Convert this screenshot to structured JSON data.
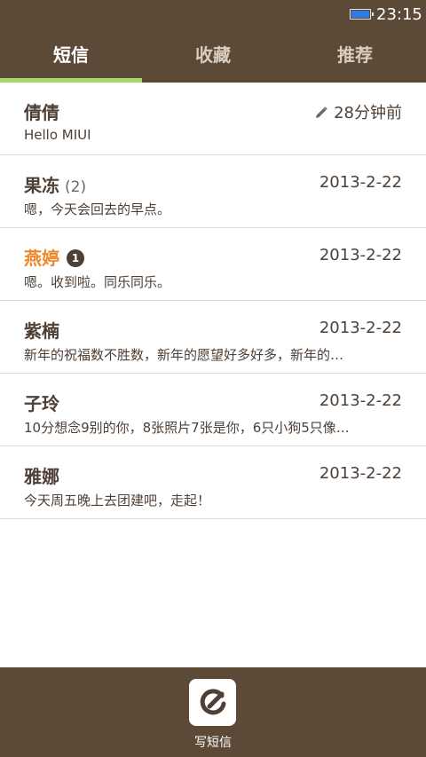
{
  "status_bar": {
    "time": "23:15",
    "battery_icon": "battery-icon"
  },
  "tabs": [
    {
      "label": "短信",
      "active": true
    },
    {
      "label": "收藏",
      "active": false
    },
    {
      "label": "推荐",
      "active": false
    }
  ],
  "colors": {
    "header_bg": "#5c4a37",
    "active_indicator": "#a6d86a",
    "unread_name": "#f0872a"
  },
  "conversations": [
    {
      "name": "倩倩",
      "count": "",
      "unread": "",
      "date": "28分钟前",
      "draft": true,
      "preview": "Hello MIUI"
    },
    {
      "name": "果冻",
      "count": "(2)",
      "unread": "",
      "date": "2013-2-22",
      "draft": false,
      "preview": "嗯，今天会回去的早点。"
    },
    {
      "name": "燕婷",
      "count": "",
      "unread": "1",
      "date": "2013-2-22",
      "draft": false,
      "preview": "嗯。收到啦。同乐同乐。"
    },
    {
      "name": "紫楠",
      "count": "",
      "unread": "",
      "date": "2013-2-22",
      "draft": false,
      "preview": "新年的祝福数不胜数，新年的愿望好多好多，新年的…"
    },
    {
      "name": "子玲",
      "count": "",
      "unread": "",
      "date": "2013-2-22",
      "draft": false,
      "preview": "10分想念9别的你，8张照片7张是你，6只小狗5只像…"
    },
    {
      "name": "雅娜",
      "count": "",
      "unread": "",
      "date": "2013-2-22",
      "draft": false,
      "preview": "今天周五晚上去团建吧，走起！"
    }
  ],
  "bottom_bar": {
    "compose_label": "写短信",
    "compose_icon": "compose-icon"
  }
}
